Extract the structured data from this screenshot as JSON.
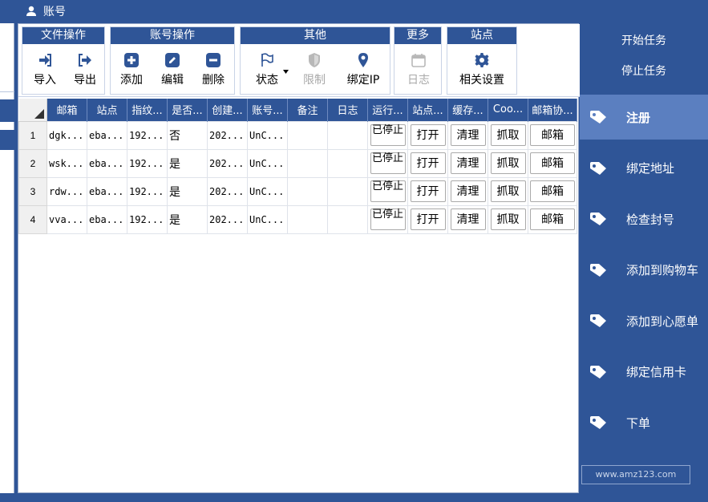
{
  "window": {
    "title": "账号"
  },
  "ribbon": {
    "groups": [
      {
        "title": "文件操作",
        "buttons": [
          {
            "label": "导入",
            "icon": "import-icon"
          },
          {
            "label": "导出",
            "icon": "export-icon"
          }
        ]
      },
      {
        "title": "账号操作",
        "buttons": [
          {
            "label": "添加",
            "icon": "plus-icon"
          },
          {
            "label": "编辑",
            "icon": "edit-icon"
          },
          {
            "label": "删除",
            "icon": "minus-icon"
          }
        ]
      },
      {
        "title": "其他",
        "buttons": [
          {
            "label": "状态",
            "icon": "flag-icon"
          },
          {
            "label": "限制",
            "icon": "shield-icon"
          },
          {
            "label": "绑定IP",
            "icon": "location-pin-icon"
          }
        ]
      },
      {
        "title": "更多",
        "buttons": [
          {
            "label": "日志",
            "icon": "calendar-icon"
          }
        ]
      },
      {
        "title": "站点",
        "buttons": [
          {
            "label": "相关设置",
            "icon": "gear-icon"
          }
        ]
      }
    ]
  },
  "grid": {
    "columns": [
      "邮箱",
      "站点",
      "指纹...",
      "是否...",
      "创建...",
      "账号...",
      "备注",
      "日志",
      "运行...",
      "站点...",
      "缓存...",
      "Coo...",
      "邮箱协..."
    ],
    "rows": [
      {
        "num": "1",
        "email": "dgk...",
        "site": "eba...",
        "fp": "192...",
        "flag": "否",
        "created": "202...",
        "acct": "UnC...",
        "run": "已停止",
        "open": "打开",
        "clear": "清理",
        "grab": "抓取",
        "mailbox": "邮箱"
      },
      {
        "num": "2",
        "email": "wsk...",
        "site": "eba...",
        "fp": "192...",
        "flag": "是",
        "created": "202...",
        "acct": "UnC...",
        "run": "已停止",
        "open": "打开",
        "clear": "清理",
        "grab": "抓取",
        "mailbox": "邮箱"
      },
      {
        "num": "3",
        "email": "rdw...",
        "site": "eba...",
        "fp": "192...",
        "flag": "是",
        "created": "202...",
        "acct": "UnC...",
        "run": "已停止",
        "open": "打开",
        "clear": "清理",
        "grab": "抓取",
        "mailbox": "邮箱"
      },
      {
        "num": "4",
        "email": "vva...",
        "site": "eba...",
        "fp": "192...",
        "flag": "是",
        "created": "202...",
        "acct": "UnC...",
        "run": "已停止",
        "open": "打开",
        "clear": "清理",
        "grab": "抓取",
        "mailbox": "邮箱"
      }
    ]
  },
  "right_panel": {
    "start_task": "开始任务",
    "stop_task": "停止任务",
    "items": [
      "注册",
      "绑定地址",
      "检查封号",
      "添加到购物车",
      "添加到心愿单",
      "绑定信用卡",
      "下单"
    ],
    "watermark": "www.amz123.com"
  },
  "colors": {
    "primary": "#2f5597",
    "active_item": "#5b7fc0"
  }
}
